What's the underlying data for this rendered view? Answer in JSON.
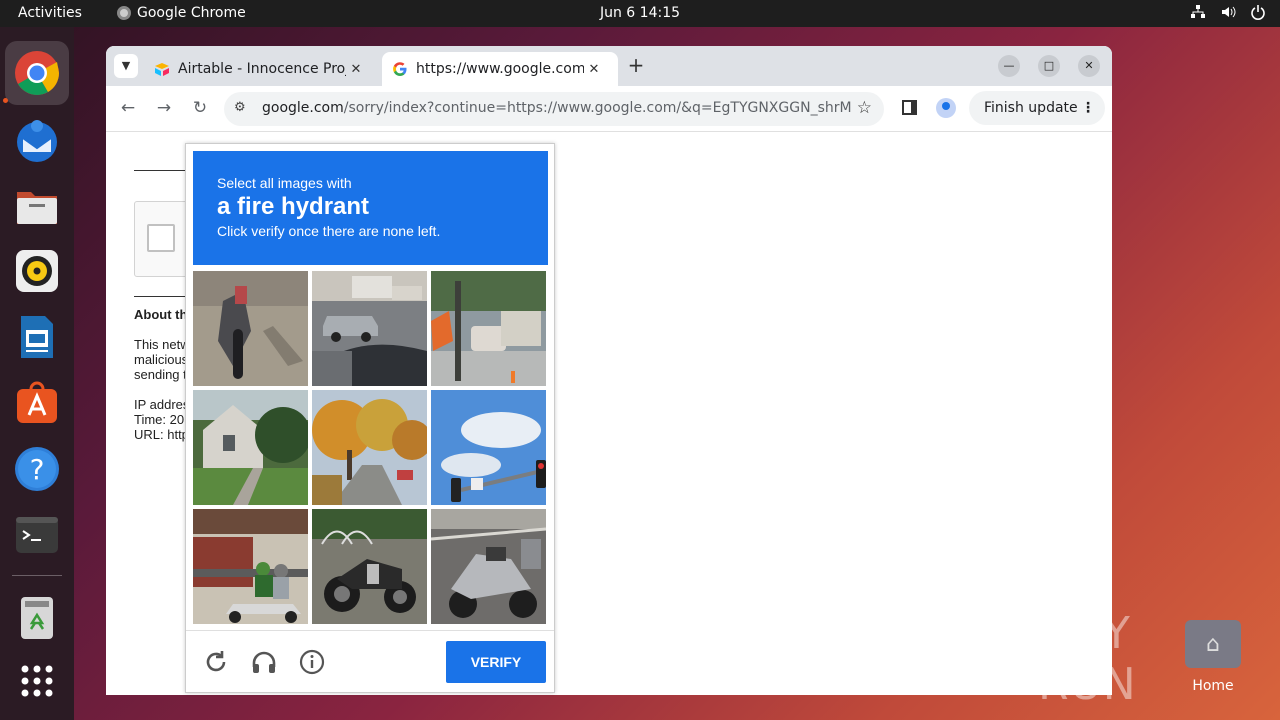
{
  "topbar": {
    "activities": "Activities",
    "app_name": "Google Chrome",
    "clock": "Jun 6  14:15"
  },
  "dock": {
    "apps": [
      "google-chrome",
      "thunderbird",
      "files",
      "rhythmbox",
      "libreoffice-impress",
      "ubuntu-software",
      "help",
      "terminal",
      "trash",
      "show-apps"
    ]
  },
  "browser": {
    "tabs": [
      {
        "title": "Airtable - Innocence Proj",
        "favicon": "airtable-icon"
      },
      {
        "title": "https://www.google.com",
        "favicon": "google-icon"
      }
    ],
    "new_tab": "+",
    "url_host": "google.com",
    "url_rest": "/sorry/index?continue=https://www.google.com/&q=EgTYGNXGGN_shrMGIjCZl...",
    "finish_update": "Finish update"
  },
  "page": {
    "about_heading": "About th",
    "para_lines": [
      "This netw",
      "malicious",
      "sending t"
    ],
    "ip_line": "IP addres",
    "time_line": "Time: 20",
    "url_line": "URL: http"
  },
  "captcha": {
    "line1": "Select all images with",
    "line2": "a fire hydrant",
    "line3": "Click verify once there are none left.",
    "tiles": [
      "scooter-closeup",
      "street-cars",
      "street-intersection",
      "house-yard",
      "autumn-street",
      "traffic-light-sky",
      "scooter-riders",
      "motorcycle-sidecar",
      "parked-scooters"
    ],
    "verify_label": "VERIFY"
  },
  "desktop": {
    "watermark": "ANY RUN",
    "home_label": "Home"
  },
  "colors": {
    "captcha_blue": "#1a73e8",
    "topbar": "#1e1e1e",
    "ubuntu_orange": "#e95420"
  }
}
